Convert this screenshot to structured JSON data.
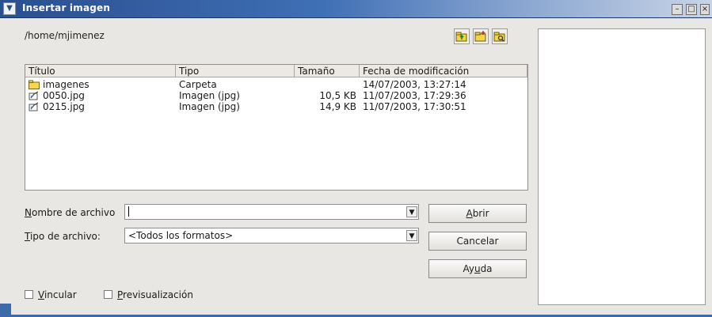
{
  "window": {
    "title": "Insertar imagen",
    "controls": [
      "minimize-icon",
      "maximize-icon",
      "close-icon"
    ]
  },
  "path": "/home/mjimenez",
  "toolbar": {
    "icons": [
      "folder-up-icon",
      "new-folder-icon",
      "folder-view-icon"
    ]
  },
  "file_list": {
    "columns": [
      "Título",
      "Tipo",
      "Tamaño",
      "Fecha de modificación"
    ],
    "rows": [
      {
        "icon": "folder-icon",
        "name": "imagenes",
        "type": "Carpeta",
        "size": "",
        "date": "14/07/2003, 13:27:14"
      },
      {
        "icon": "image-file-icon",
        "name": "0050.jpg",
        "type": "Imagen (jpg)",
        "size": "10,5 KB",
        "date": "11/07/2003, 17:29:36"
      },
      {
        "icon": "image-file-icon",
        "name": "0215.jpg",
        "type": "Imagen (jpg)",
        "size": "14,9 KB",
        "date": "11/07/2003, 17:30:51"
      }
    ]
  },
  "filename": {
    "label_ul": "N",
    "label_rest": "ombre de archivo",
    "value": ""
  },
  "filetype": {
    "label_ul": "T",
    "label_rest": "ipo de archivo:",
    "value": "<Todos los formatos>"
  },
  "buttons": {
    "open_ul": "A",
    "open_rest": "brir",
    "cancel": "Cancelar",
    "help_pre": "Ay",
    "help_ul": "u",
    "help_post": "da"
  },
  "options": {
    "link_ul": "V",
    "link_rest": "incular",
    "preview_ul": "P",
    "preview_rest": "revisualización"
  }
}
